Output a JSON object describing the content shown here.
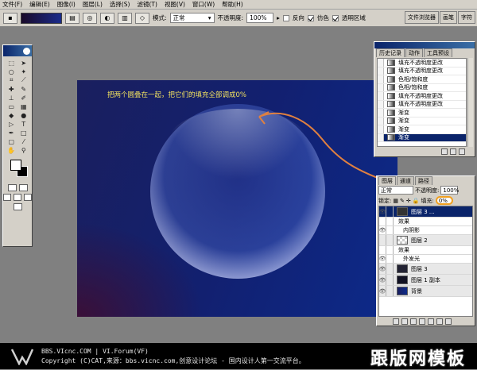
{
  "menubar": [
    "文件(F)",
    "编辑(E)",
    "图像(I)",
    "图层(L)",
    "选择(S)",
    "滤镜(T)",
    "视图(V)",
    "窗口(W)",
    "帮助(H)"
  ],
  "options": {
    "mode_label": "模式:",
    "mode_value": "正常",
    "opacity_label": "不透明度:",
    "opacity_value": "100%",
    "reverse_label": "反向",
    "dither_label": "仿色",
    "transparency_label": "透明区域"
  },
  "well_tabs": [
    "文件浏览器",
    "画笔",
    "字符"
  ],
  "canvas": {
    "annotation": "把两个圆叠在一起，把它们的填充全部调成0%",
    "colors": {
      "bg_left": "#1a1f5e",
      "bg_right": "#0c2a8a",
      "arrow": "#e08040",
      "annotation": "#f0e060"
    }
  },
  "history": {
    "tabs": [
      "历史记录",
      "动作",
      "工具预设"
    ],
    "items": [
      "填充不透明度更改",
      "填充不透明度更改",
      "色相/饱和度",
      "色相/饱和度",
      "填充不透明度更改",
      "填充不透明度更改",
      "渐变",
      "渐变",
      "渐变",
      "渐变"
    ]
  },
  "layers": {
    "tabs": [
      "图层",
      "通道",
      "路径"
    ],
    "blend_mode": "正常",
    "opacity_label": "不透明度:",
    "opacity_value": "100%",
    "lock_label": "锁定:",
    "fill_label": "填充:",
    "fill_value": "0%",
    "rows": [
      {
        "name": "图层 3 ...",
        "kind": "layer",
        "selected": true
      },
      {
        "name": "效果",
        "kind": "effect-header"
      },
      {
        "name": "内阴影",
        "kind": "effect"
      },
      {
        "name": "图层 2",
        "kind": "layer"
      },
      {
        "name": "效果",
        "kind": "effect-header"
      },
      {
        "name": "外发光",
        "kind": "effect"
      },
      {
        "name": "图层 3",
        "kind": "layer"
      },
      {
        "name": "图层 1 副本",
        "kind": "layer"
      },
      {
        "name": "背景",
        "kind": "layer"
      }
    ]
  },
  "footer": {
    "line1": "BBS.VIcnc.COM | VI.Forum(VF)",
    "line2": "Copyright (C)CAT,来源：bbs.vicnc.com,创意设计论坛 - 国内设计人第一交流平台。",
    "brand": "跟版网模板",
    "logo": "VI"
  }
}
